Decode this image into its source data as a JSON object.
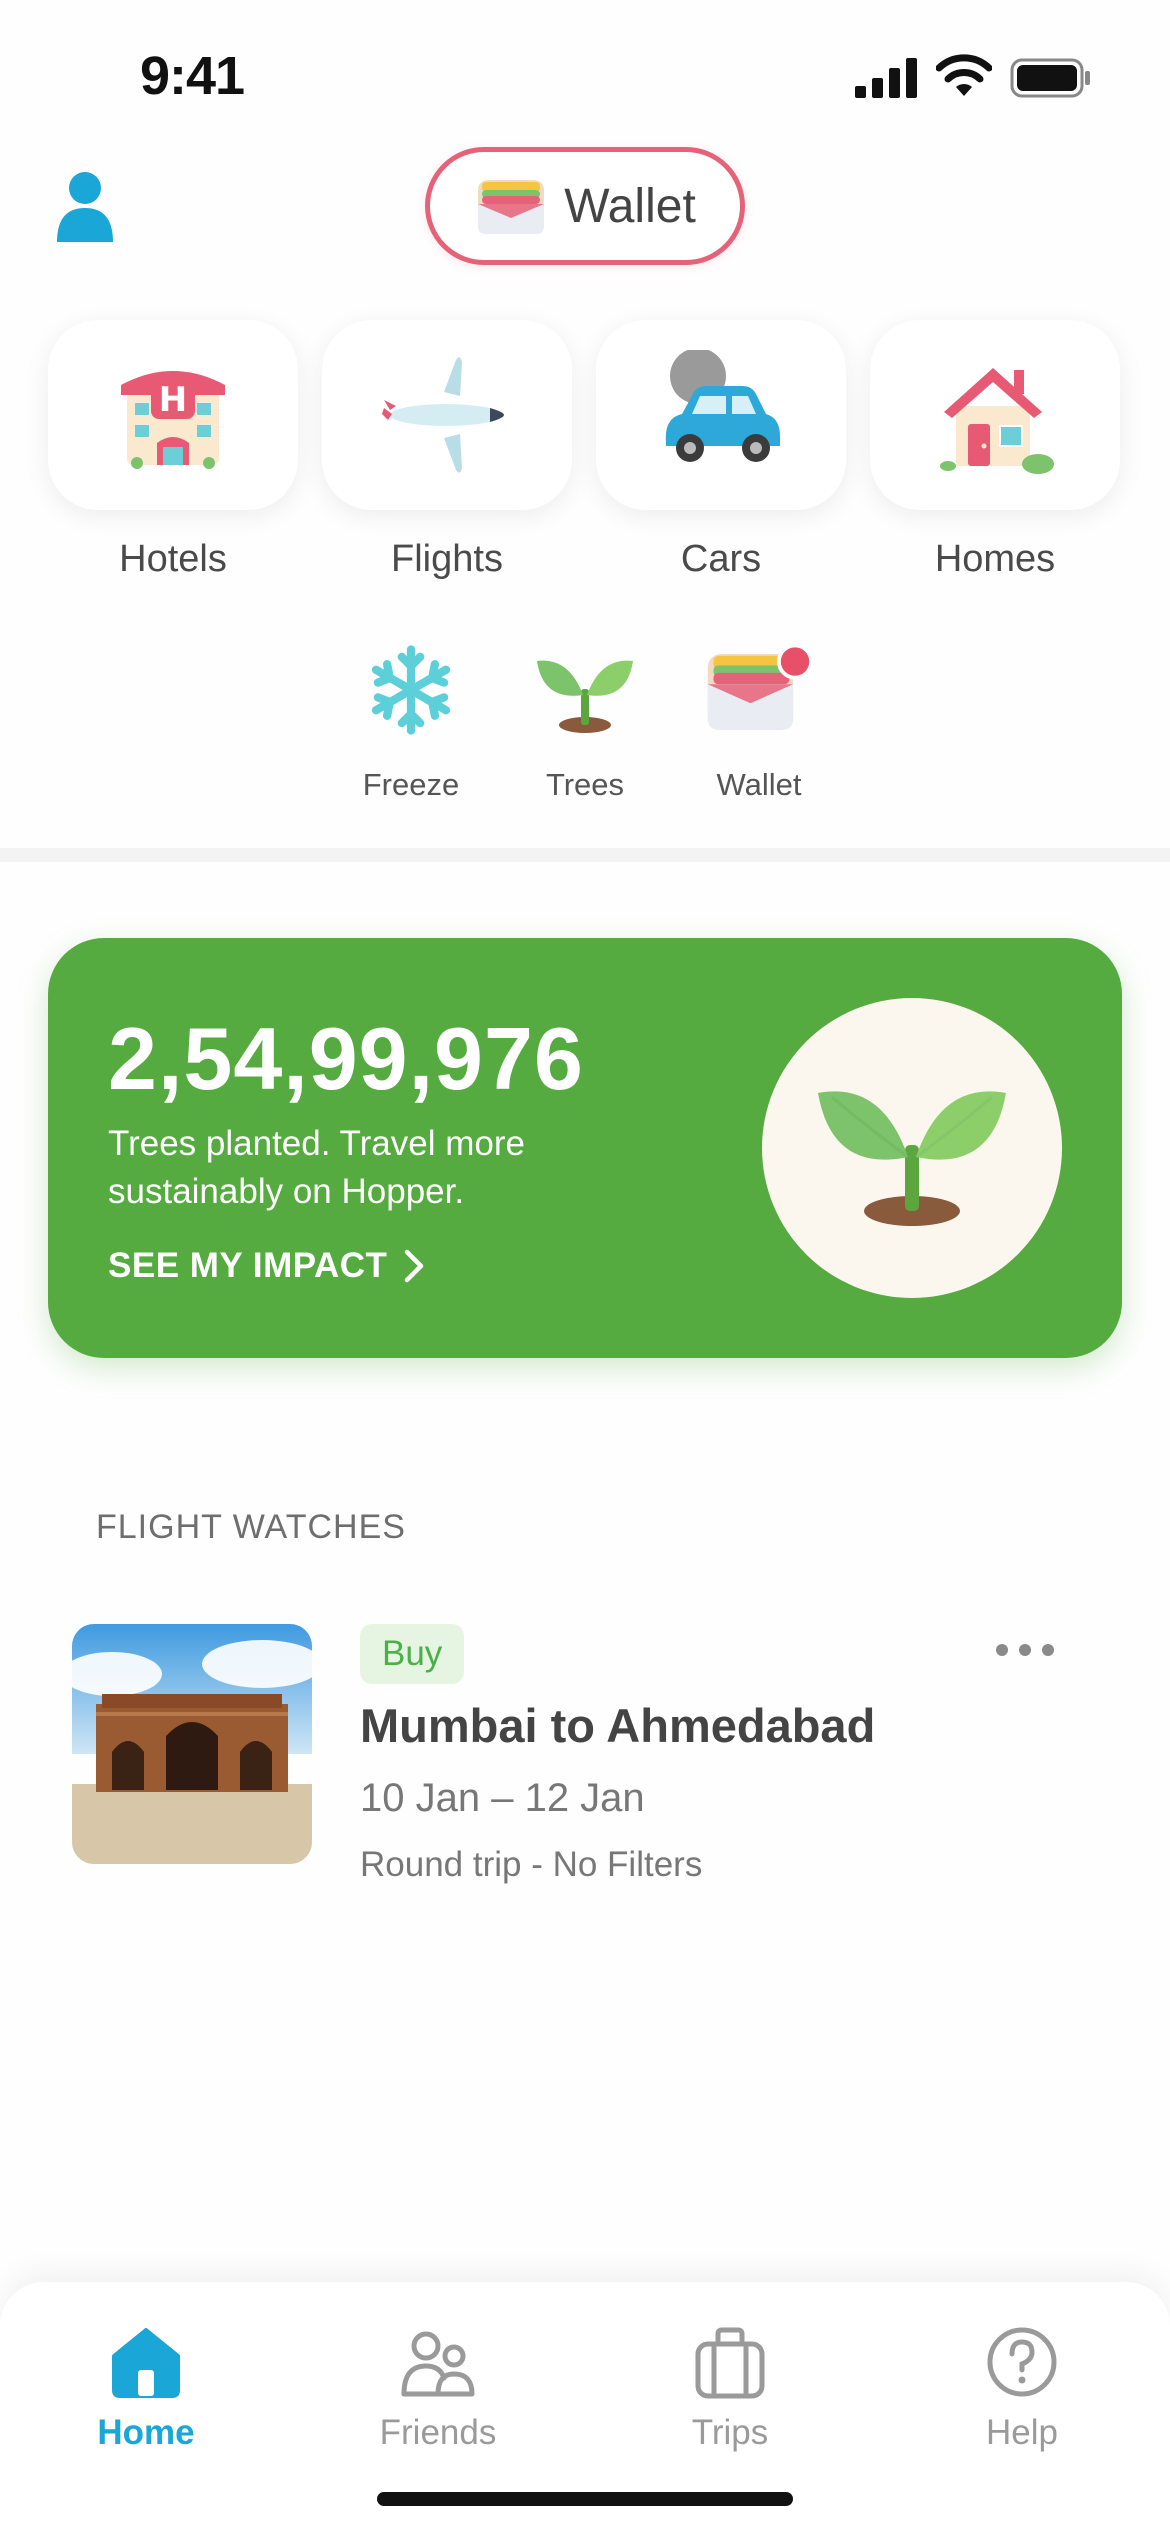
{
  "status_bar": {
    "time": "9:41"
  },
  "header": {
    "wallet_label": "Wallet"
  },
  "categories": [
    {
      "label": "Hotels",
      "icon": "hotel-icon"
    },
    {
      "label": "Flights",
      "icon": "airplane-icon"
    },
    {
      "label": "Cars",
      "icon": "car-icon"
    },
    {
      "label": "Homes",
      "icon": "house-icon"
    }
  ],
  "shortcuts": [
    {
      "label": "Freeze",
      "icon": "snowflake-icon"
    },
    {
      "label": "Trees",
      "icon": "sprout-icon"
    },
    {
      "label": "Wallet",
      "icon": "wallet-icon"
    }
  ],
  "impact": {
    "count": "2,54,99,976",
    "description": "Trees planted. Travel more sustainably on Hopper.",
    "link_label": "SEE MY IMPACT",
    "card_color": "#55aa40"
  },
  "flight_watches": {
    "section_title": "FLIGHT WATCHES",
    "items": [
      {
        "badge": "Buy",
        "route": "Mumbai to Ahmedabad",
        "dates": "10 Jan – 12 Jan",
        "trip_type": "Round trip - No Filters"
      }
    ]
  },
  "tabs": [
    {
      "label": "Home",
      "icon": "home-icon",
      "active": true
    },
    {
      "label": "Friends",
      "icon": "friends-icon",
      "active": false
    },
    {
      "label": "Trips",
      "icon": "suitcase-icon",
      "active": false
    },
    {
      "label": "Help",
      "icon": "help-icon",
      "active": false
    }
  ],
  "colors": {
    "accent": "#1aa6d6",
    "wallet_border": "#e66278",
    "buy_green": "#4bb04a"
  }
}
